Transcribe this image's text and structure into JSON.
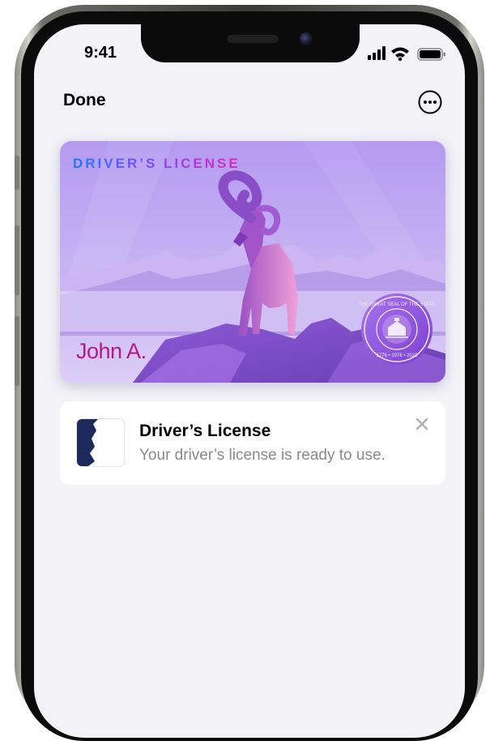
{
  "status_bar": {
    "time": "9:41"
  },
  "nav": {
    "done_label": "Done",
    "more_icon": "ellipsis-circle-icon"
  },
  "card": {
    "title": "DRIVER’S LICENSE",
    "holder_name": "John A.",
    "seal_ring_text": "THE GREAT SEAL OF THE STATE",
    "seal_years": "1776 • 1976 • 2021"
  },
  "notification": {
    "title": "Driver’s License",
    "message": "Your driver’s license is ready to use.",
    "close_icon": "close-icon"
  },
  "colors": {
    "screen_bg": "#f2f2f7",
    "card_purple": "#b49af0",
    "name_magenta": "#b31a86",
    "muted_text": "#8a8a8e"
  }
}
